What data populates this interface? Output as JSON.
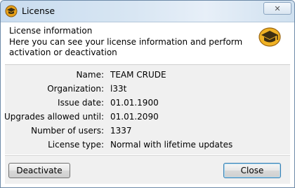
{
  "window": {
    "title": "License"
  },
  "header": {
    "title": "License information",
    "description": "Here you can see your license information and perform activation or deactivation"
  },
  "details": [
    {
      "label": "Name:",
      "value": "TEAM CRUDE"
    },
    {
      "label": "Organization:",
      "value": "l33t"
    },
    {
      "label": "Issue date:",
      "value": "01.01.1900"
    },
    {
      "label": "Upgrades allowed until:",
      "value": "01.01.2090"
    },
    {
      "label": "Number of users:",
      "value": "1337"
    },
    {
      "label": "License type:",
      "value": "Normal with lifetime updates"
    }
  ],
  "buttons": {
    "deactivate": "Deactivate",
    "close": "Close"
  },
  "colors": {
    "titlebar": "#d8e6f3",
    "panel": "#f0f0f0",
    "logo_orange": "#e8a21a",
    "logo_dark": "#4a3a1a"
  },
  "icons": [
    "app-logo-icon",
    "close-window-icon"
  ]
}
